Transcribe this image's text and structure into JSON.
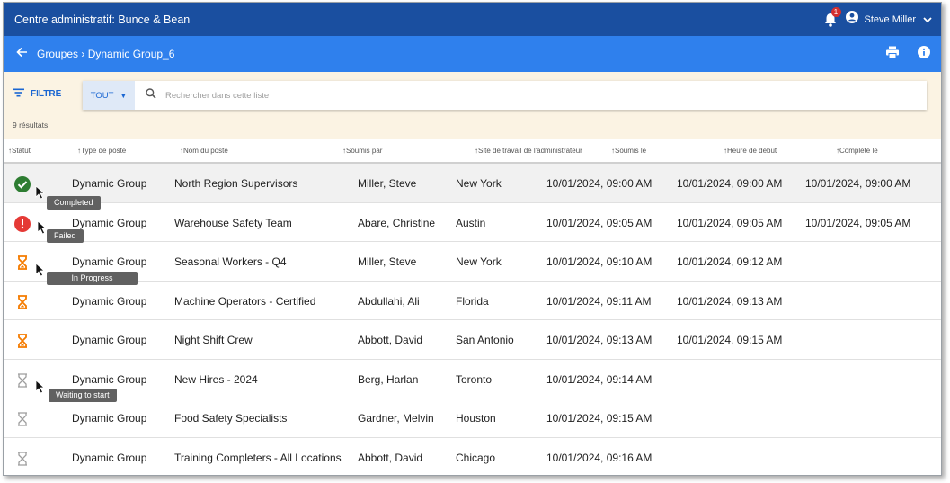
{
  "app": {
    "title": "Centre administratif: Bunce & Bean",
    "notifications_count": "1",
    "user_name": "Steve Miller"
  },
  "breadcrumb": {
    "text": "Groupes › Dynamic Group_6"
  },
  "filter": {
    "label": "FILTRE",
    "scope": "TOUT",
    "search_placeholder": "Rechercher dans cette liste",
    "results": "9 résultats"
  },
  "columns": {
    "status": "↑Statut",
    "type": "↑Type de poste",
    "name": "↑Nom du poste",
    "submitted_by": "↑Soumis par",
    "site": "↑Site de travail de l'administrateur",
    "submitted_on": "↑Soumis le",
    "start": "↑Heure de début",
    "completed": "↑Complété le"
  },
  "rows": [
    {
      "status": "completed",
      "type": "Dynamic Group",
      "name": "North Region Supervisors",
      "by": "Miller, Steve",
      "site": "New York",
      "submitted": "10/01/2024, 09:00 AM",
      "start": "10/01/2024, 09:00 AM",
      "completed": "10/01/2024, 09:00 AM"
    },
    {
      "status": "failed",
      "type": "Dynamic Group",
      "name": "Warehouse Safety Team",
      "by": "Abare, Christine",
      "site": "Austin",
      "submitted": "10/01/2024, 09:05 AM",
      "start": "10/01/2024, 09:05 AM",
      "completed": "10/01/2024, 09:05 AM"
    },
    {
      "status": "in-progress",
      "type": "Dynamic Group",
      "name": "Seasonal Workers - Q4",
      "by": "Miller, Steve",
      "site": "New York",
      "submitted": "10/01/2024, 09:10 AM",
      "start": "10/01/2024, 09:12 AM",
      "completed": ""
    },
    {
      "status": "in-progress",
      "type": "Dynamic Group",
      "name": "Machine Operators - Certified",
      "by": "Abdullahi, Ali",
      "site": "Florida",
      "submitted": "10/01/2024, 09:11 AM",
      "start": "10/01/2024, 09:13 AM",
      "completed": ""
    },
    {
      "status": "in-progress",
      "type": "Dynamic Group",
      "name": "Night Shift Crew",
      "by": "Abbott, David",
      "site": "San Antonio",
      "submitted": "10/01/2024, 09:13 AM",
      "start": "10/01/2024, 09:15 AM",
      "completed": ""
    },
    {
      "status": "waiting",
      "type": "Dynamic Group",
      "name": "New Hires - 2024",
      "by": "Berg, Harlan",
      "site": "Toronto",
      "submitted": "10/01/2024, 09:14 AM",
      "start": "",
      "completed": ""
    },
    {
      "status": "waiting",
      "type": "Dynamic Group",
      "name": "Food Safety Specialists",
      "by": "Gardner, Melvin",
      "site": "Houston",
      "submitted": "10/01/2024, 09:15 AM",
      "start": "",
      "completed": ""
    },
    {
      "status": "waiting",
      "type": "Dynamic Group",
      "name": "Training Completers - All Locations",
      "by": "Abbott, David",
      "site": "Chicago",
      "submitted": "10/01/2024, 09:16 AM",
      "start": "",
      "completed": ""
    }
  ],
  "tooltips": {
    "completed": "Completed",
    "failed": "Failed",
    "in_progress": "In Progress",
    "waiting": "Waiting to start"
  },
  "colors": {
    "topbar": "#1a4fa0",
    "subbar": "#2f80ed",
    "filter_bg": "#fbf3e3",
    "completed": "#2e7d32",
    "failed": "#e53935",
    "in_progress": "#f57c00",
    "waiting": "#9e9e9e"
  },
  "icons": {
    "completed": "check-circle-icon",
    "failed": "error-circle-icon",
    "in-progress": "hourglass-icon",
    "waiting": "hourglass-outline-icon"
  }
}
